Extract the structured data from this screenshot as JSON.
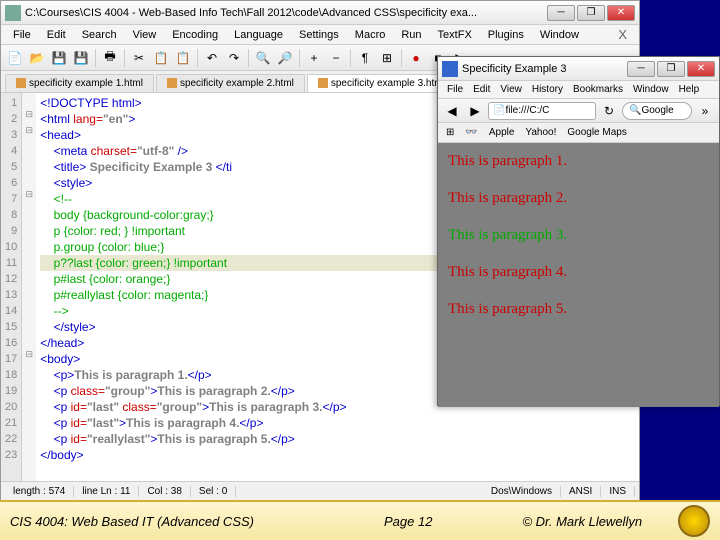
{
  "editor": {
    "title": "C:\\Courses\\CIS 4004 - Web-Based Info Tech\\Fall 2012\\code\\Advanced CSS\\specificity exa...",
    "menu": [
      "File",
      "Edit",
      "Search",
      "View",
      "Encoding",
      "Language",
      "Settings",
      "Macro",
      "Run",
      "TextFX",
      "Plugins",
      "Window"
    ],
    "tabs": [
      "specificity example 1.html",
      "specificity example 2.html",
      "specificity example 3.html"
    ],
    "lines": [
      "1",
      "2",
      "3",
      "4",
      "5",
      "6",
      "7",
      "8",
      "9",
      "10",
      "11",
      "12",
      "13",
      "14",
      "15",
      "16",
      "17",
      "18",
      "19",
      "20",
      "21",
      "22",
      "23"
    ],
    "code": {
      "l1": "<!DOCTYPE html>",
      "l2a": "<html ",
      "l2b": "lang=",
      "l2c": "\"en\"",
      "l2d": ">",
      "l3": "<head>",
      "l4a": "    <meta ",
      "l4b": "charset=",
      "l4c": "\"utf-8\"",
      "l4d": " />",
      "l5a": "    <title> ",
      "l5b": "Specificity Example 3 ",
      "l5c": "</ti",
      "l6": "    <style>",
      "l7": "    <!--",
      "l8": "    body {background-color:gray;}",
      "l9": "    p {color: red; } !important",
      "l10": "    p.group {color: blue;}",
      "l11": "    p??last {color: green;} !important",
      "l12": "    p#last {color: orange;}",
      "l13": "    p#reallylast {color: magenta;}",
      "l14": "    -->",
      "l15": "    </style>",
      "l16": "</head>",
      "l17": "<body>",
      "l18a": "    <p>",
      "l18b": "This is paragraph 1.",
      "l18c": "</p>",
      "l19a": "    <p ",
      "l19b": "class=",
      "l19c": "\"group\"",
      "l19d": ">",
      "l19e": "This is paragraph 2.",
      "l19f": "</p>",
      "l20a": "    <p ",
      "l20b": "id=",
      "l20c": "\"last\" ",
      "l20d": "class=",
      "l20e": "\"group\"",
      "l20f": ">",
      "l20g": "This is paragraph 3.",
      "l20h": "</p>",
      "l21a": "    <p ",
      "l21b": "id=",
      "l21c": "\"last\"",
      "l21d": ">",
      "l21e": "This is paragraph 4.",
      "l21f": "</p>",
      "l22a": "    <p ",
      "l22b": "id=",
      "l22c": "\"reallylast\"",
      "l22d": ">",
      "l22e": "This is paragraph 5.",
      "l22f": "</p>",
      "l23": "</body>"
    },
    "status": {
      "length": "length : 574",
      "line": "line Ln : 11",
      "col": "Col : 38",
      "sel": "Sel : 0",
      "eol": "Dos\\Windows",
      "enc": "ANSI",
      "ins": "INS"
    }
  },
  "browser": {
    "title": "Specificity Example 3",
    "menu": [
      "File",
      "Edit",
      "View",
      "History",
      "Bookmarks",
      "Window",
      "Help"
    ],
    "url": "file:///C:/C",
    "search_placeholder": "Google",
    "bookmarks": [
      "Apple",
      "Yahoo!",
      "Google Maps"
    ],
    "p1": "This is paragraph 1.",
    "p2": "This is paragraph 2.",
    "p3": "This is paragraph 3.",
    "p4": "This is paragraph 4.",
    "p5": "This is paragraph 5."
  },
  "footer": {
    "course": "CIS 4004: Web Based IT (Advanced CSS)",
    "page": "Page 12",
    "copy": "© Dr. Mark Llewellyn"
  }
}
